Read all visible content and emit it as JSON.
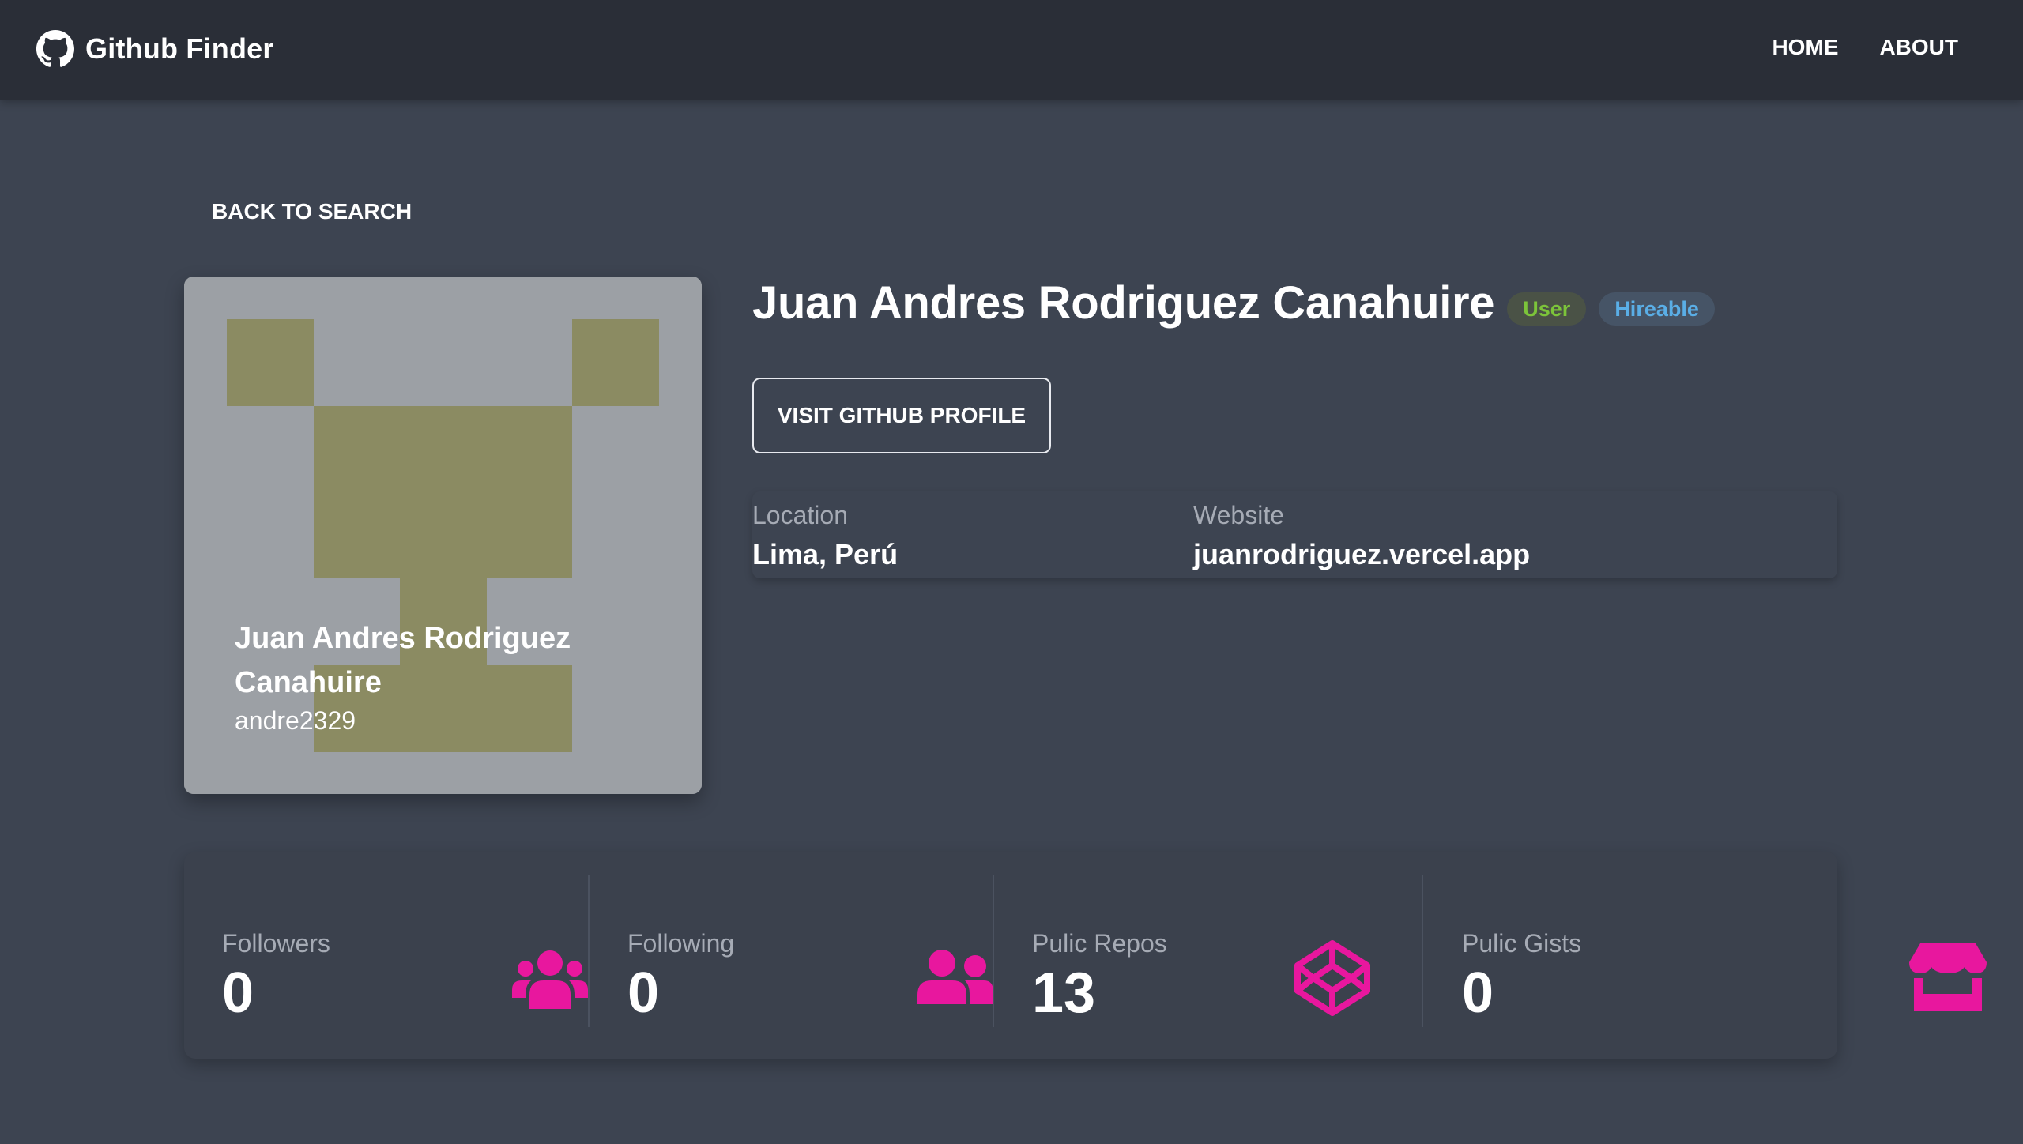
{
  "navbar": {
    "brand_name": "Github Finder",
    "brand_icon": "github-icon",
    "links": [
      "HOME",
      "ABOUT"
    ]
  },
  "back_label": "BACK TO SEARCH",
  "profile": {
    "name": "Juan Andres Rodriguez Canahuire",
    "login": "andre2329",
    "badges": {
      "type": "User",
      "hireable": "Hireable"
    },
    "visit_label": "VISIT GITHUB PROFILE",
    "location_label": "Location",
    "location": "Lima, Perú",
    "website_label": "Website",
    "website": "juanrodriguez.vercel.app"
  },
  "stats": [
    {
      "label": "Followers",
      "value": "0",
      "icon": "users-icon"
    },
    {
      "label": "Following",
      "value": "0",
      "icon": "user-friends-icon"
    },
    {
      "label": "Pulic Repos",
      "value": "13",
      "icon": "codepen-icon"
    },
    {
      "label": "Pulic Gists",
      "value": "0",
      "icon": "store-icon"
    }
  ],
  "colors": {
    "background": "#3d4451",
    "navbar": "#2a2e37",
    "accent": "#e8179e",
    "badge_user": "#7cc43a",
    "badge_hireable": "#5aaee6",
    "avatar_bg": "#9ca0a5",
    "avatar_fg": "#8b8b62"
  }
}
